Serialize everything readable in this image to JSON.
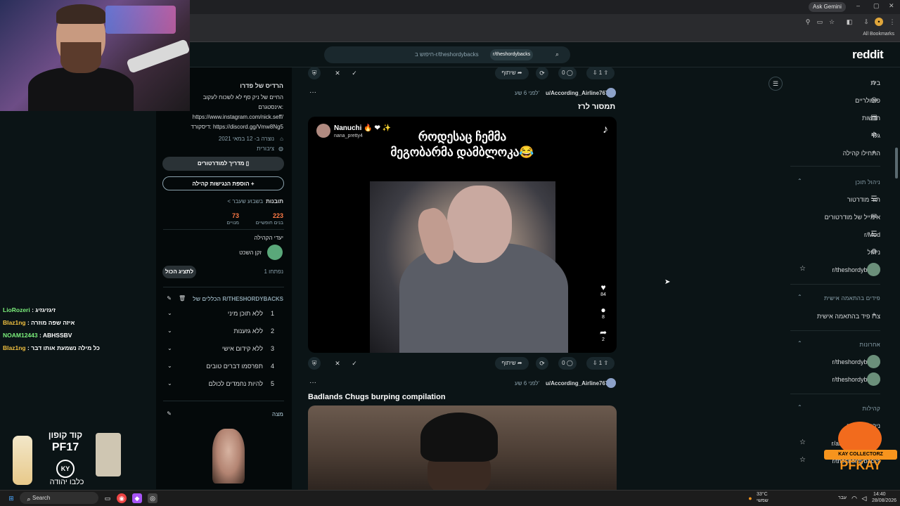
{
  "browser": {
    "ask_gemini": "Ask Gemini",
    "all_bookmarks": "All Bookmarks"
  },
  "reddit": {
    "logo": "reddit",
    "search": {
      "chip": "r/theshordybacks",
      "placeholder": "חיפוש ב-r/theshordybacks"
    }
  },
  "community_panel": {
    "title": "הרדיס של פדרו",
    "description_line1": "החיים של ניק סף לא לשכוח לעקוב",
    "description_line2": "אינסטגרם:",
    "link1": "https://www.instagram.com/nick.seff/",
    "link2": "דיסקורד: https://discord.gg/Vmw8Ng5",
    "created": "נוצרה ב- 12 במאי 2021",
    "visibility": "ציבורית",
    "mod_guide_button": "מדריך למודרטורים",
    "add_widget_button": "הוספת הנגישות קהילה",
    "insights_label": "תובנות",
    "insights_period": "< בשבוע שעבר",
    "stat1_value": "223",
    "stat1_label": "בנים חופשיים",
    "stat2_value": "73",
    "stat2_label": "מנויים",
    "moderators_label": "יעדי הקהילה",
    "mod_name": "זקן השכט",
    "open_count": "1 נפתחו",
    "show_all_button": "לתציג הכול",
    "rules_title": "הכללים של R/THESHORDYBACKS",
    "rules": [
      {
        "num": "1",
        "text": "ללא תוכן מיני"
      },
      {
        "num": "2",
        "text": "ללא גזענות"
      },
      {
        "num": "3",
        "text": "ללא קידום אישי"
      },
      {
        "num": "4",
        "text": "תפרסמו דברים טובים"
      },
      {
        "num": "5",
        "text": "להיות נחמדים לכולם"
      }
    ],
    "bot_label": "מצה"
  },
  "feed": {
    "top_actions": {
      "upvotes": "1",
      "comments": "0",
      "share": "שיתוף"
    },
    "post1": {
      "author": "u/According_Airline767",
      "time": "לפני 6 שע'",
      "title": "תמסור לרז",
      "tiktok_user": "Nanuchi",
      "tiktok_emojis": "🔥 ❤ ✨",
      "tiktok_handle": "nana_pretty4",
      "caption_line1": "როდესაც ჩემმა",
      "caption_line2": "მეგობარმა დამბლოკა😂",
      "likes": "84",
      "comments_count": "8",
      "shares": "2",
      "actions": {
        "upvotes": "1",
        "comments": "0",
        "share": "שיתוף"
      }
    },
    "post2": {
      "author": "u/According_Airline767",
      "time": "לפני 6 שע'",
      "title": "Badlands Chugs burping compilation"
    }
  },
  "right_nav": {
    "items": [
      {
        "label": "בית",
        "icon": "⌂"
      },
      {
        "label": "פופולריים",
        "icon": "◎"
      },
      {
        "label": "חדשות",
        "icon": "▤"
      },
      {
        "label": "גלוי",
        "icon": "✲"
      },
      {
        "label": "התחילו קהילה",
        "icon": "+"
      }
    ],
    "section_mod": "ניהול תוכן",
    "mod_items": [
      {
        "label": "תור מודרטור",
        "icon": "☰"
      },
      {
        "label": "אימייל של מודרטורים",
        "icon": "✉"
      },
      {
        "label": "r/Mod",
        "icon": "☰"
      },
      {
        "label": "ניהול",
        "icon": "⚙"
      },
      {
        "label": "r/theshordybacks",
        "icon": ""
      }
    ],
    "section_custom": "פידים בהתאמה אישית",
    "custom_item": "צרו פיד בהתאמה אישית",
    "section_recent": "אחרונות",
    "recent_items": [
      "r/theshordybacks",
      "r/theshordybacks"
    ],
    "section_communities": "קהילות",
    "community_items": [
      "ניהול קהילות",
      "r/announcements",
      "r/theshordybacks"
    ]
  },
  "chat": [
    {
      "user": "LioRozeri",
      "msg": "זיגזיגזיג",
      "color": "#7cf07c"
    },
    {
      "user": "Blaz1ng",
      "msg": "איזה שפה מוזרה",
      "color": "#f0c040"
    },
    {
      "user": "NOAM12443",
      "msg": "ABHSSBV",
      "color": "#7cf07c"
    },
    {
      "user": "Blaz1ng",
      "msg": "כל מילה נשמעת אותו דבר",
      "color": "#f0c040"
    }
  ],
  "promo": {
    "title": "קוד קופון",
    "code": "PF17",
    "logo": "KY",
    "sub": "כלבו יהודה"
  },
  "brand": {
    "band": "KAY COLLECTORZ",
    "name": "PFKAY"
  },
  "taskbar": {
    "search": "Search",
    "weather_temp": "33°C",
    "weather_desc": "שמשי",
    "lang": "עבר",
    "time": "14:40",
    "date": "28/08/2026"
  }
}
